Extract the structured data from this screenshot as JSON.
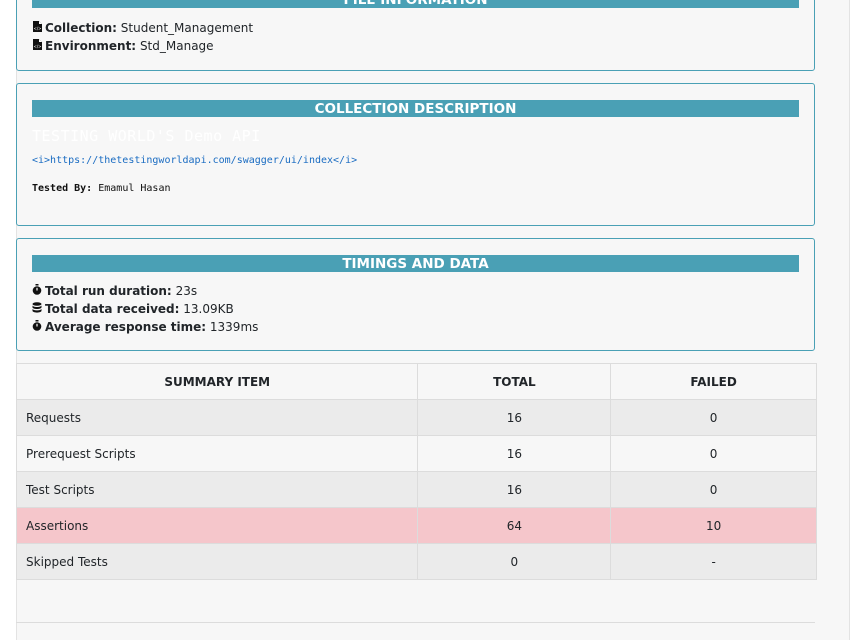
{
  "file_info": {
    "header": "FILE INFORMATION",
    "collection_label": "Collection:",
    "collection_value": "Student_Management",
    "environment_label": "Environment:",
    "environment_value": "Std_Manage"
  },
  "collection_description": {
    "header": "COLLECTION DESCRIPTION",
    "title": "TESTING WORLD'S Demo API",
    "link": "<i>https://thetestingworldapi.com/swagger/ui/index</i>",
    "tested_by_label": "Tested By:",
    "tested_by_value": "Emamul Hasan"
  },
  "timings": {
    "header": "TIMINGS AND DATA",
    "run_duration_label": "Total run duration:",
    "run_duration_value": "23s",
    "data_received_label": "Total data received:",
    "data_received_value": "13.09KB",
    "avg_response_label": "Average response time:",
    "avg_response_value": "1339ms"
  },
  "summary": {
    "columns": [
      "SUMMARY ITEM",
      "TOTAL",
      "FAILED"
    ],
    "rows": [
      {
        "item": "Requests",
        "total": "16",
        "failed": "0"
      },
      {
        "item": "Prerequest Scripts",
        "total": "16",
        "failed": "0"
      },
      {
        "item": "Test Scripts",
        "total": "16",
        "failed": "0"
      },
      {
        "item": "Assertions",
        "total": "64",
        "failed": "10"
      },
      {
        "item": "Skipped Tests",
        "total": "0",
        "failed": "-"
      }
    ]
  },
  "colors": {
    "accent": "#4aa0b5",
    "failed_row": "#f5c6cb",
    "link": "#1a6cc2"
  },
  "icons": {
    "file": "file-code-icon",
    "stopwatch": "stopwatch-icon",
    "database": "database-icon"
  }
}
